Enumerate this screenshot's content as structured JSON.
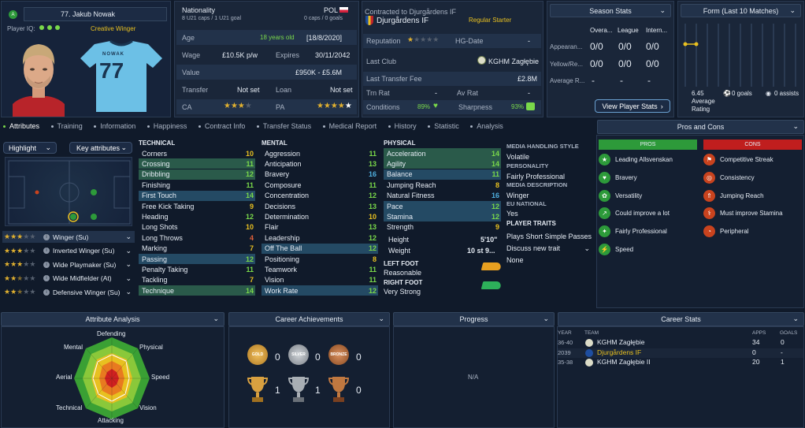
{
  "player": {
    "number_name": "77. Jakub Nowak",
    "iq_label": "Player IQ:",
    "role": "Creative Winger",
    "shirt_name": "NOWAK",
    "shirt_number": "77"
  },
  "nationality": {
    "label": "Nationality",
    "country": "POL",
    "caps": "8 U21 caps / 1 U21 goal",
    "senior": "0 caps / 0 goals"
  },
  "details": {
    "age_label": "Age",
    "age": "18 years old",
    "dob": "[18/8/2020]",
    "wage_label": "Wage",
    "wage": "£10.5K p/w",
    "expires_label": "Expires",
    "expires": "30/11/2042",
    "value_label": "Value",
    "value": "£950K - £5.6M",
    "transfer_label": "Transfer",
    "transfer": "Not set",
    "loan_label": "Loan",
    "loan": "Not set",
    "ca_label": "CA",
    "pa_label": "PA"
  },
  "contract": {
    "title": "Contracted to Djurgårdens IF",
    "club": "Djurgårdens IF",
    "status": "Regular Starter",
    "rep_label": "Reputation",
    "hg_label": "HG-Date",
    "hg_value": "-",
    "last_club_label": "Last Club",
    "last_club": "KGHM Zagłębie",
    "fee_label": "Last Transfer Fee",
    "fee": "£2.8M",
    "trn_label": "Trn Rat",
    "trn_value": "-",
    "av_label": "Av Rat",
    "av_value": "-",
    "cond_label": "Conditions",
    "cond_value": "89%",
    "sharp_label": "Sharpness",
    "sharp_value": "93%"
  },
  "season": {
    "header": "Season Stats",
    "cols": [
      "Overa...",
      "League",
      "Intern..."
    ],
    "rows": [
      {
        "label": "Appearan...",
        "vals": [
          "0/0",
          "0/0",
          "0/0"
        ]
      },
      {
        "label": "Yellow/Re...",
        "vals": [
          "0/0",
          "0/0",
          "0/0"
        ]
      },
      {
        "label": "Average R...",
        "vals": [
          "-",
          "-",
          "-"
        ]
      }
    ],
    "button": "View Player Stats"
  },
  "form": {
    "header": "Form (Last 10 Matches)",
    "rating": "6.45",
    "rating_label": "Average Rating",
    "goals": "0 goals",
    "assists": "0 assists"
  },
  "tabs": [
    "Attributes",
    "Training",
    "Information",
    "Happiness",
    "Contract Info",
    "Transfer Status",
    "Medical Report",
    "History",
    "Statistic",
    "Analysis"
  ],
  "left": {
    "highlight": "Highlight",
    "key_attr": "Key attributes",
    "roles": [
      {
        "stars": 3,
        "name": "Winger (Su)"
      },
      {
        "stars": 3,
        "name": "Inverted Winger (Su)"
      },
      {
        "stars": 3,
        "name": "Wide Playmaker (Su)"
      },
      {
        "stars": 2.5,
        "name": "Wide Midfielder (At)"
      },
      {
        "stars": 2.5,
        "name": "Defensive Winger (Su)"
      }
    ]
  },
  "technical": {
    "title": "TECHNICAL",
    "items": [
      {
        "n": "Corners",
        "v": "10",
        "c": "#e8c020",
        "h": ""
      },
      {
        "n": "Crossing",
        "v": "11",
        "c": "#7ad94a",
        "h": "g"
      },
      {
        "n": "Dribbling",
        "v": "12",
        "c": "#7ad94a",
        "h": "g"
      },
      {
        "n": "Finishing",
        "v": "11",
        "c": "#7ad94a",
        "h": ""
      },
      {
        "n": "First Touch",
        "v": "14",
        "c": "#7ad94a",
        "h": "b"
      },
      {
        "n": "Free Kick Taking",
        "v": "9",
        "c": "#e8c020",
        "h": ""
      },
      {
        "n": "Heading",
        "v": "12",
        "c": "#7ad94a",
        "h": ""
      },
      {
        "n": "Long Shots",
        "v": "10",
        "c": "#e8c020",
        "h": ""
      },
      {
        "n": "Long Throws",
        "v": "4",
        "c": "#e0603a",
        "h": ""
      },
      {
        "n": "Marking",
        "v": "7",
        "c": "#e8c020",
        "h": ""
      },
      {
        "n": "Passing",
        "v": "12",
        "c": "#7ad94a",
        "h": "b"
      },
      {
        "n": "Penalty Taking",
        "v": "11",
        "c": "#7ad94a",
        "h": ""
      },
      {
        "n": "Tackling",
        "v": "7",
        "c": "#e8c020",
        "h": ""
      },
      {
        "n": "Technique",
        "v": "14",
        "c": "#7ad94a",
        "h": "g"
      }
    ]
  },
  "mental": {
    "title": "MENTAL",
    "items": [
      {
        "n": "Aggression",
        "v": "11",
        "c": "#7ad94a",
        "h": ""
      },
      {
        "n": "Anticipation",
        "v": "13",
        "c": "#7ad94a",
        "h": ""
      },
      {
        "n": "Bravery",
        "v": "16",
        "c": "#4fb0e0",
        "h": ""
      },
      {
        "n": "Composure",
        "v": "11",
        "c": "#7ad94a",
        "h": ""
      },
      {
        "n": "Concentration",
        "v": "12",
        "c": "#7ad94a",
        "h": ""
      },
      {
        "n": "Decisions",
        "v": "13",
        "c": "#7ad94a",
        "h": ""
      },
      {
        "n": "Determination",
        "v": "10",
        "c": "#e8c020",
        "h": ""
      },
      {
        "n": "Flair",
        "v": "13",
        "c": "#7ad94a",
        "h": ""
      },
      {
        "n": "Leadership",
        "v": "12",
        "c": "#7ad94a",
        "h": ""
      },
      {
        "n": "Off The Ball",
        "v": "12",
        "c": "#7ad94a",
        "h": "b"
      },
      {
        "n": "Positioning",
        "v": "8",
        "c": "#e8c020",
        "h": ""
      },
      {
        "n": "Teamwork",
        "v": "11",
        "c": "#7ad94a",
        "h": ""
      },
      {
        "n": "Vision",
        "v": "11",
        "c": "#7ad94a",
        "h": ""
      },
      {
        "n": "Work Rate",
        "v": "12",
        "c": "#7ad94a",
        "h": "b"
      }
    ]
  },
  "physical": {
    "title": "PHYSICAL",
    "items": [
      {
        "n": "Acceleration",
        "v": "14",
        "c": "#7ad94a",
        "h": "g"
      },
      {
        "n": "Agility",
        "v": "14",
        "c": "#7ad94a",
        "h": "g"
      },
      {
        "n": "Balance",
        "v": "11",
        "c": "#7ad94a",
        "h": "b"
      },
      {
        "n": "Jumping Reach",
        "v": "8",
        "c": "#e8c020",
        "h": ""
      },
      {
        "n": "Natural Fitness",
        "v": "16",
        "c": "#4fb0e0",
        "h": ""
      },
      {
        "n": "Pace",
        "v": "12",
        "c": "#7ad94a",
        "h": "b"
      },
      {
        "n": "Stamina",
        "v": "12",
        "c": "#7ad94a",
        "h": "b"
      },
      {
        "n": "Strength",
        "v": "9",
        "c": "#e8c020",
        "h": ""
      }
    ],
    "height_label": "Height",
    "height": "5'10\"",
    "weight_label": "Weight",
    "weight": "10 st 9...",
    "lf_label": "LEFT FOOT",
    "lf": "Reasonable",
    "rf_label": "RIGHT FOOT",
    "rf": "Very Strong"
  },
  "media": {
    "style_label": "MEDIA HANDLING STYLE",
    "style": "Volatile",
    "pers_label": "PERSONALITY",
    "pers": "Fairly Professional",
    "desc_label": "MEDIA DESCRIPTION",
    "desc": "Winger",
    "eu_label": "EU NATIONAL",
    "eu": "Yes",
    "traits_label": "PLAYER TRAITS",
    "trait1": "Plays Short Simple Passes",
    "discuss": "Discuss new trait",
    "none": "None"
  },
  "proscons": {
    "header": "Pros and Cons",
    "pros_label": "PROS",
    "cons_label": "CONS",
    "pros": [
      "Leading Allsvenskan",
      "Bravery",
      "Versatility",
      "Could improve a lot",
      "Fairly Professional",
      "Speed"
    ],
    "cons": [
      "Competitive Streak",
      "Consistency",
      "Jumping Reach",
      "Must improve Stamina",
      "Peripheral"
    ]
  },
  "bottom": {
    "attr_analysis": "Attribute Analysis",
    "radar_labels": [
      "Defending",
      "Physical",
      "Speed",
      "Vision",
      "Attacking",
      "Technical",
      "Aerial",
      "Mental"
    ],
    "career_ach": "Career Achievements",
    "ach_counts": [
      "0",
      "0",
      "0",
      "1",
      "1",
      "0"
    ],
    "medal_labels": [
      "GOLD",
      "SILVER",
      "BRONZE"
    ],
    "progress": "Progress",
    "progress_na": "N/A",
    "career_stats": "Career Stats",
    "cs_cols": [
      "YEAR",
      "TEAM",
      "APPS",
      "GOALS"
    ],
    "cs_rows": [
      {
        "year": "36-40",
        "team": "KGHM Zagłębie",
        "apps": "34",
        "goals": "0"
      },
      {
        "year": "2039",
        "team": "Djurgårdens IF",
        "apps": "0",
        "goals": "-"
      },
      {
        "year": "35-38",
        "team": "KGHM Zagłębie II",
        "apps": "20",
        "goals": "1"
      }
    ]
  },
  "colors": {
    "accent": "#7ad94a",
    "bg": "#101a2a",
    "panel": "#1a2639",
    "pro": "#2d9a3a",
    "con": "#c9431e"
  }
}
